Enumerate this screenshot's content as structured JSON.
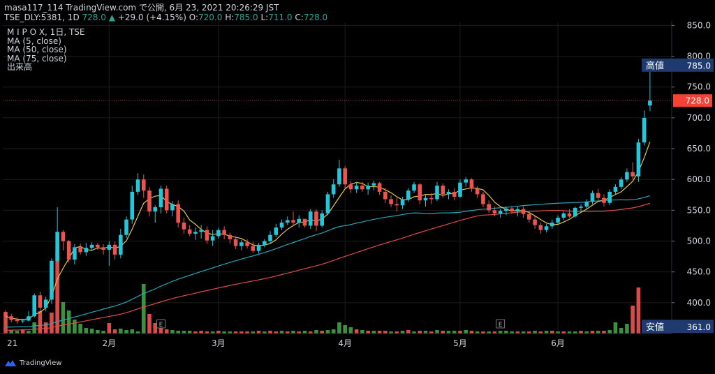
{
  "header": {
    "line1_prefix": "masa117_114 TradingView.com で公開, 6月 23, 2021 20:26:29 JST",
    "line2_symbol": "TSE_DLY:5381, 1D",
    "last": "728.0",
    "arrow": "▲",
    "change": "+29.0 (+4.15%)",
    "o_label": "O:",
    "o_val": "720.0",
    "h_label": "H:",
    "h_val": "785.0",
    "l_label": "L:",
    "l_val": "711.0",
    "c_label": "C:",
    "c_val": "728.0"
  },
  "legend": {
    "title": "M I P O X, 1日, TSE",
    "ma5": "MA (5, close)",
    "ma50": "MA (50, close)",
    "ma75": "MA (75, close)",
    "volume": "出来高"
  },
  "branding": {
    "name": "TradingView"
  },
  "colors": {
    "up": "#26c6da",
    "down": "#ef5350",
    "vol_up": "#43a047",
    "vol_down": "#ef5350",
    "ma5": "#e6c84f",
    "ma50": "#26a6b8",
    "ma75": "#e24b4b",
    "label_bg": "#1e3a6e",
    "price_bg": "#f44336"
  },
  "chart_data": {
    "type": "candlestick",
    "y_axis": {
      "min": 350,
      "max": 855,
      "ticks": [
        400,
        450,
        500,
        550,
        600,
        650,
        700,
        750,
        800,
        850
      ]
    },
    "x_ticks": [
      {
        "label": "21",
        "i": 0
      },
      {
        "label": "2月",
        "i": 18
      },
      {
        "label": "3月",
        "i": 37
      },
      {
        "label": "4月",
        "i": 59
      },
      {
        "label": "5月",
        "i": 79
      },
      {
        "label": "6月",
        "i": 96
      }
    ],
    "markers": [
      {
        "label": "高値",
        "value": "785.0",
        "price": 785
      },
      {
        "label": "安値",
        "value": "361.0",
        "price": 361
      }
    ],
    "last_price": {
      "value": "728.0",
      "price": 728
    },
    "earnings_flags": [
      {
        "i": 27,
        "label": "E"
      },
      {
        "i": 86,
        "label": "E"
      }
    ],
    "candles": [
      [
        385,
        388,
        365,
        378
      ],
      [
        378,
        382,
        368,
        372
      ],
      [
        372,
        376,
        366,
        370
      ],
      [
        370,
        374,
        367,
        371
      ],
      [
        371,
        386,
        370,
        378
      ],
      [
        378,
        415,
        376,
        412
      ],
      [
        412,
        418,
        385,
        392
      ],
      [
        392,
        410,
        386,
        405
      ],
      [
        405,
        472,
        398,
        468
      ],
      [
        468,
        555,
        465,
        515
      ],
      [
        515,
        518,
        485,
        500
      ],
      [
        500,
        502,
        465,
        470
      ],
      [
        470,
        495,
        462,
        490
      ],
      [
        490,
        496,
        478,
        482
      ],
      [
        482,
        497,
        476,
        489
      ],
      [
        489,
        498,
        484,
        494
      ],
      [
        494,
        497,
        486,
        490
      ],
      [
        490,
        495,
        478,
        486
      ],
      [
        486,
        500,
        460,
        494
      ],
      [
        494,
        499,
        470,
        478
      ],
      [
        478,
        520,
        472,
        510
      ],
      [
        510,
        540,
        505,
        535
      ],
      [
        535,
        590,
        528,
        580
      ],
      [
        580,
        610,
        575,
        600
      ],
      [
        600,
        608,
        570,
        582
      ],
      [
        582,
        588,
        540,
        548
      ],
      [
        548,
        558,
        530,
        555
      ],
      [
        555,
        590,
        545,
        585
      ],
      [
        585,
        590,
        545,
        550
      ],
      [
        550,
        565,
        540,
        560
      ],
      [
        560,
        566,
        522,
        530
      ],
      [
        530,
        538,
        512,
        519
      ],
      [
        519,
        526,
        508,
        512
      ],
      [
        512,
        522,
        502,
        515
      ],
      [
        515,
        526,
        504,
        518
      ],
      [
        518,
        524,
        496,
        501
      ],
      [
        501,
        518,
        492,
        508
      ],
      [
        508,
        522,
        504,
        518
      ],
      [
        518,
        524,
        503,
        510
      ],
      [
        510,
        514,
        496,
        503
      ],
      [
        503,
        508,
        487,
        492
      ],
      [
        492,
        502,
        485,
        498
      ],
      [
        498,
        503,
        488,
        492
      ],
      [
        492,
        499,
        481,
        484
      ],
      [
        484,
        497,
        480,
        494
      ],
      [
        494,
        503,
        490,
        500
      ],
      [
        500,
        516,
        495,
        510
      ],
      [
        510,
        528,
        506,
        522
      ],
      [
        522,
        535,
        518,
        530
      ],
      [
        530,
        540,
        526,
        534
      ],
      [
        534,
        548,
        525,
        530
      ],
      [
        530,
        542,
        522,
        536
      ],
      [
        536,
        536,
        522,
        525
      ],
      [
        525,
        552,
        520,
        548
      ],
      [
        548,
        552,
        516,
        525
      ],
      [
        525,
        550,
        522,
        545
      ],
      [
        545,
        580,
        542,
        576
      ],
      [
        576,
        600,
        570,
        592
      ],
      [
        592,
        632,
        588,
        618
      ],
      [
        618,
        622,
        585,
        592
      ],
      [
        592,
        598,
        578,
        584
      ],
      [
        584,
        596,
        578,
        590
      ],
      [
        590,
        596,
        580,
        584
      ],
      [
        584,
        595,
        575,
        590
      ],
      [
        590,
        598,
        582,
        594
      ],
      [
        594,
        596,
        575,
        580
      ],
      [
        580,
        586,
        562,
        568
      ],
      [
        568,
        574,
        555,
        560
      ],
      [
        560,
        570,
        548,
        558
      ],
      [
        558,
        572,
        552,
        568
      ],
      [
        568,
        586,
        564,
        582
      ],
      [
        582,
        596,
        578,
        592
      ],
      [
        592,
        594,
        560,
        566
      ],
      [
        566,
        575,
        556,
        570
      ],
      [
        570,
        578,
        560,
        568
      ],
      [
        568,
        596,
        565,
        590
      ],
      [
        590,
        594,
        570,
        576
      ],
      [
        576,
        584,
        568,
        580
      ],
      [
        580,
        586,
        566,
        572
      ],
      [
        572,
        600,
        570,
        595
      ],
      [
        595,
        604,
        588,
        600
      ],
      [
        600,
        602,
        580,
        585
      ],
      [
        585,
        589,
        570,
        576
      ],
      [
        576,
        580,
        555,
        560
      ],
      [
        560,
        566,
        546,
        550
      ],
      [
        550,
        556,
        540,
        545
      ],
      [
        545,
        552,
        538,
        549
      ],
      [
        549,
        556,
        542,
        553
      ],
      [
        553,
        557,
        544,
        548
      ],
      [
        548,
        556,
        540,
        552
      ],
      [
        552,
        556,
        538,
        544
      ],
      [
        544,
        548,
        530,
        535
      ],
      [
        535,
        541,
        520,
        526
      ],
      [
        526,
        530,
        512,
        518
      ],
      [
        518,
        528,
        514,
        524
      ],
      [
        524,
        535,
        520,
        530
      ],
      [
        530,
        542,
        528,
        538
      ],
      [
        538,
        548,
        534,
        545
      ],
      [
        545,
        552,
        538,
        540
      ],
      [
        540,
        556,
        538,
        554
      ],
      [
        554,
        560,
        548,
        556
      ],
      [
        556,
        568,
        552,
        564
      ],
      [
        564,
        582,
        560,
        578
      ],
      [
        578,
        585,
        566,
        570
      ],
      [
        570,
        576,
        556,
        562
      ],
      [
        562,
        584,
        558,
        580
      ],
      [
        580,
        592,
        576,
        588
      ],
      [
        588,
        604,
        584,
        600
      ],
      [
        600,
        618,
        596,
        612
      ],
      [
        612,
        628,
        600,
        605
      ],
      [
        605,
        666,
        596,
        660
      ],
      [
        660,
        712,
        655,
        700
      ],
      [
        720,
        785,
        711,
        728
      ]
    ],
    "volumes": [
      [
        26,
        "d"
      ],
      [
        5,
        "u"
      ],
      [
        4,
        "u"
      ],
      [
        6,
        "d"
      ],
      [
        4,
        "u"
      ],
      [
        16,
        "u"
      ],
      [
        32,
        "d"
      ],
      [
        16,
        "d"
      ],
      [
        30,
        "d"
      ],
      [
        118,
        "d"
      ],
      [
        45,
        "u"
      ],
      [
        33,
        "u"
      ],
      [
        20,
        "u"
      ],
      [
        14,
        "u"
      ],
      [
        8,
        "u"
      ],
      [
        7,
        "u"
      ],
      [
        5,
        "u"
      ],
      [
        4,
        "u"
      ],
      [
        15,
        "d"
      ],
      [
        6,
        "d"
      ],
      [
        7,
        "u"
      ],
      [
        5,
        "u"
      ],
      [
        6,
        "u"
      ],
      [
        3,
        "u"
      ],
      [
        71,
        "u"
      ],
      [
        28,
        "d"
      ],
      [
        15,
        "d"
      ],
      [
        10,
        "d"
      ],
      [
        6,
        "d"
      ],
      [
        5,
        "u"
      ],
      [
        4,
        "u"
      ],
      [
        4,
        "u"
      ],
      [
        4,
        "u"
      ],
      [
        3,
        "d"
      ],
      [
        4,
        "d"
      ],
      [
        3,
        "d"
      ],
      [
        3,
        "u"
      ],
      [
        4,
        "d"
      ],
      [
        3,
        "u"
      ],
      [
        3,
        "u"
      ],
      [
        3,
        "d"
      ],
      [
        3,
        "d"
      ],
      [
        3,
        "d"
      ],
      [
        3,
        "u"
      ],
      [
        4,
        "d"
      ],
      [
        3,
        "u"
      ],
      [
        4,
        "d"
      ],
      [
        3,
        "d"
      ],
      [
        4,
        "u"
      ],
      [
        3,
        "d"
      ],
      [
        4,
        "u"
      ],
      [
        3,
        "d"
      ],
      [
        4,
        "u"
      ],
      [
        3,
        "d"
      ],
      [
        5,
        "u"
      ],
      [
        4,
        "d"
      ],
      [
        5,
        "u"
      ],
      [
        6,
        "u"
      ],
      [
        16,
        "u"
      ],
      [
        12,
        "u"
      ],
      [
        9,
        "u"
      ],
      [
        6,
        "d"
      ],
      [
        5,
        "u"
      ],
      [
        4,
        "d"
      ],
      [
        4,
        "u"
      ],
      [
        4,
        "d"
      ],
      [
        4,
        "d"
      ],
      [
        3,
        "u"
      ],
      [
        3,
        "d"
      ],
      [
        4,
        "u"
      ],
      [
        5,
        "d"
      ],
      [
        3,
        "u"
      ],
      [
        4,
        "d"
      ],
      [
        4,
        "u"
      ],
      [
        3,
        "d"
      ],
      [
        5,
        "u"
      ],
      [
        4,
        "d"
      ],
      [
        4,
        "u"
      ],
      [
        4,
        "u"
      ],
      [
        4,
        "d"
      ],
      [
        5,
        "u"
      ],
      [
        4,
        "d"
      ],
      [
        3,
        "u"
      ],
      [
        3,
        "d"
      ],
      [
        3,
        "u"
      ],
      [
        3,
        "d"
      ],
      [
        4,
        "u"
      ],
      [
        4,
        "u"
      ],
      [
        3,
        "u"
      ],
      [
        3,
        "d"
      ],
      [
        3,
        "u"
      ],
      [
        3,
        "d"
      ],
      [
        4,
        "u"
      ],
      [
        3,
        "d"
      ],
      [
        4,
        "u"
      ],
      [
        4,
        "d"
      ],
      [
        3,
        "u"
      ],
      [
        3,
        "d"
      ],
      [
        3,
        "u"
      ],
      [
        3,
        "u"
      ],
      [
        4,
        "d"
      ],
      [
        3,
        "u"
      ],
      [
        4,
        "d"
      ],
      [
        4,
        "u"
      ],
      [
        4,
        "d"
      ],
      [
        5,
        "u"
      ],
      [
        16,
        "u"
      ],
      [
        8,
        "u"
      ],
      [
        14,
        "u"
      ],
      [
        40,
        "d"
      ],
      [
        66,
        "d"
      ]
    ]
  }
}
